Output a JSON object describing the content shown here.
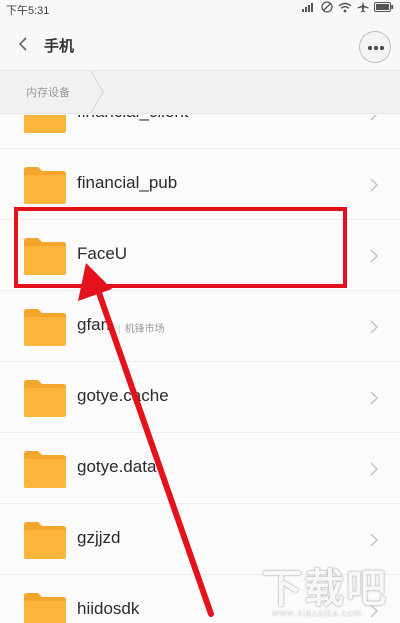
{
  "status_bar": {
    "time": "下午5:31",
    "icons": [
      "signal-icon",
      "no-data-icon",
      "wifi-icon",
      "airplane-icon",
      "battery-icon"
    ]
  },
  "header": {
    "title": "手机",
    "back_icon": "chevron-left-icon",
    "more_icon": "more-dots-icon"
  },
  "breadcrumb": {
    "items": [
      "内存设备"
    ]
  },
  "files": [
    {
      "name": "financial_client",
      "note": ""
    },
    {
      "name": "financial_pub",
      "note": ""
    },
    {
      "name": "FaceU",
      "note": ""
    },
    {
      "name": "gfan",
      "note": "机锋市场"
    },
    {
      "name": "gotye.cache",
      "note": ""
    },
    {
      "name": "gotye.data",
      "note": ""
    },
    {
      "name": "gzjjzd",
      "note": ""
    },
    {
      "name": "hiidosdk",
      "note": ""
    }
  ],
  "annotation": {
    "highlighted_item": "FaceU",
    "color": "#e3121c"
  },
  "watermark": {
    "title": "下载吧",
    "url": "www.xiazaiba.com"
  },
  "colors": {
    "folder": "#fbb53c",
    "folder_tab": "#f3a52c",
    "accent_red": "#e3121c"
  }
}
